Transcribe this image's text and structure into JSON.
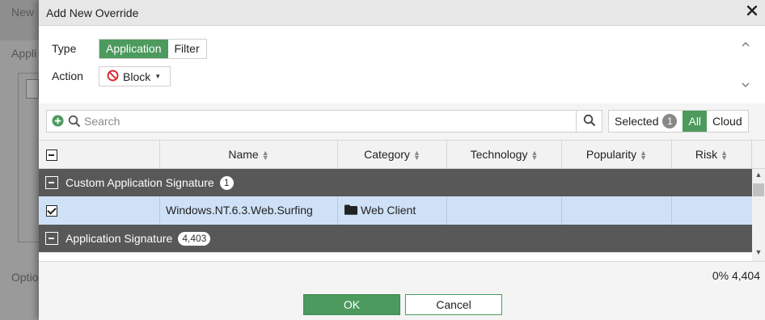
{
  "background": {
    "title_fragment": "New",
    "section_fragment": "Appli",
    "options_fragment": "Optio"
  },
  "dialog": {
    "title": "Add New Override",
    "close_glyph": "✕"
  },
  "form": {
    "type_label": "Type",
    "type_options": [
      "Application",
      "Filter"
    ],
    "type_selected": "Application",
    "action_label": "Action",
    "action_value": "Block"
  },
  "search": {
    "placeholder": "Search",
    "value": ""
  },
  "selection_filter": {
    "selected_label": "Selected",
    "selected_count": "1",
    "all_label": "All",
    "cloud_label": "Cloud",
    "active": "All"
  },
  "table": {
    "columns": [
      "Name",
      "Category",
      "Technology",
      "Popularity",
      "Risk"
    ],
    "groups": [
      {
        "label": "Custom Application Signature",
        "count": "1"
      },
      {
        "label": "Application Signature",
        "count": "4,403"
      }
    ],
    "rows": [
      {
        "checked": true,
        "name": "Windows.NT.6.3.Web.Surfing",
        "category": "Web Client",
        "technology": "",
        "popularity": "",
        "risk": ""
      }
    ]
  },
  "footer": {
    "pager_text": "0% 4,404",
    "ok_label": "OK",
    "cancel_label": "Cancel"
  },
  "colors": {
    "accent_green": "#4c9a5d",
    "group_header": "#585858",
    "selected_row": "#cfe1f7",
    "block_red": "#d9232e"
  },
  "icons": {
    "close": "close-icon",
    "block": "block-icon",
    "add": "add-circle-icon",
    "search": "search-icon",
    "folder": "folder-icon",
    "chevron_up": "chevron-up-icon",
    "chevron_down": "chevron-down-icon"
  }
}
